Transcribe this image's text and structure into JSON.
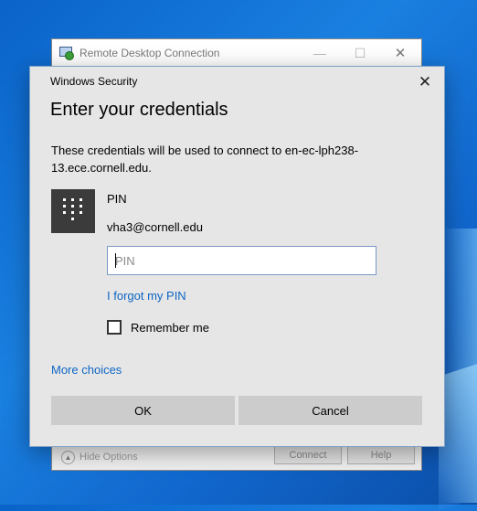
{
  "rdc": {
    "title": "Remote Desktop Connection",
    "minimize": "—",
    "maximize": "☐",
    "close": "✕",
    "hide_options": "Hide Options",
    "connect": "Connect",
    "help": "Help"
  },
  "dialog": {
    "caption": "Windows Security",
    "close": "✕",
    "heading": "Enter your credentials",
    "description": "These credentials will be used to connect to en-ec-lph238-13.ece.cornell.edu.",
    "credential_type": "PIN",
    "username": "vha3@cornell.edu",
    "pin_placeholder": "PIN",
    "forgot_pin": "I forgot my PIN",
    "remember_me": "Remember me",
    "remember_checked": false,
    "more_choices": "More choices",
    "ok": "OK",
    "cancel": "Cancel"
  },
  "colors": {
    "link": "#0f66c4",
    "desktop": "#1a80e0",
    "dialog_bg": "#e6e6e6",
    "button_bg": "#cccccc"
  },
  "icons": [
    "remote-desktop-icon",
    "close-icon",
    "pin-keypad-icon",
    "chevron-up-icon"
  ]
}
